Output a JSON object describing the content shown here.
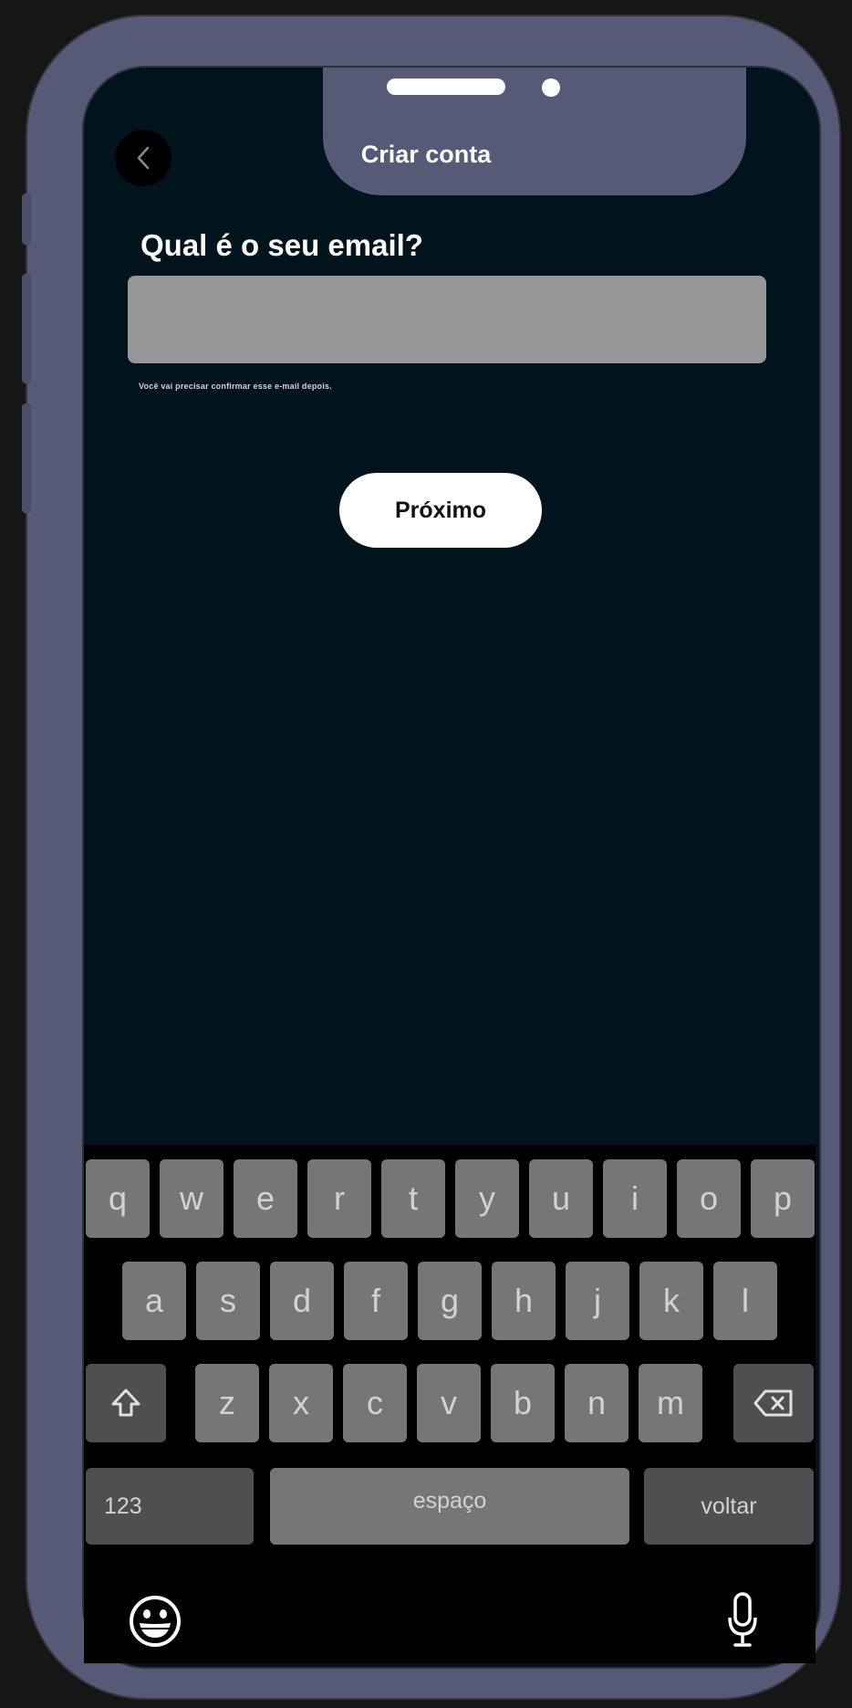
{
  "header": {
    "title": "Criar conta",
    "back_icon": "chevron-left-icon"
  },
  "form": {
    "question": "Qual é o seu email?",
    "email_value": "",
    "email_placeholder": "",
    "hint": "Você vai precisar confirmar esse e-mail depois.",
    "next_label": "Próximo"
  },
  "keyboard": {
    "row1": [
      "q",
      "w",
      "e",
      "r",
      "t",
      "y",
      "u",
      "i",
      "o",
      "p"
    ],
    "row2": [
      "a",
      "s",
      "d",
      "f",
      "g",
      "h",
      "j",
      "k",
      "l"
    ],
    "row3": [
      "z",
      "x",
      "c",
      "v",
      "b",
      "n",
      "m"
    ],
    "shift_icon": "shift-icon",
    "backspace_icon": "backspace-icon",
    "numbers_label": "123",
    "space_label": "espaço",
    "return_label": "voltar",
    "emoji_icon": "emoji-icon",
    "mic_icon": "microphone-icon"
  },
  "colors": {
    "frame": "#565a76",
    "screen_bg": "#01131d",
    "input_bg": "#979797",
    "key_bg": "#767676",
    "key_dark_bg": "#4f4f4f"
  }
}
